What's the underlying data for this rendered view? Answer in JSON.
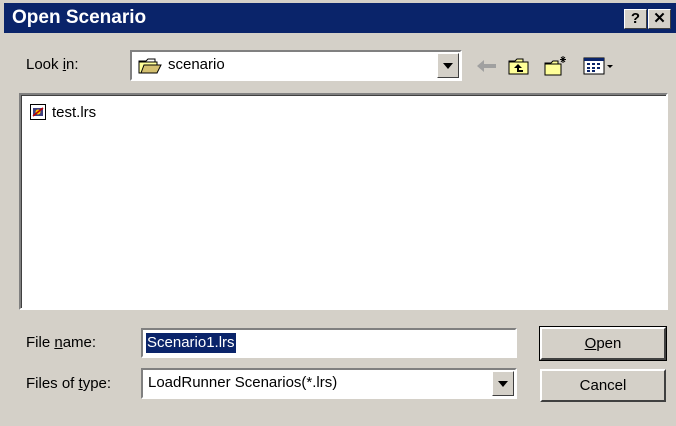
{
  "dialog": {
    "title": "Open Scenario",
    "help_label": "?",
    "close_label": "✕"
  },
  "look_in": {
    "label_pre": "Look ",
    "label_key": "i",
    "label_post": "n:",
    "value": "scenario"
  },
  "toolbar": {
    "icons": [
      "back-arrow-icon",
      "up-one-level-icon",
      "new-folder-icon",
      "view-menu-icon"
    ]
  },
  "files": [
    {
      "name": "test.lrs",
      "icon": "scenario-file-icon"
    }
  ],
  "file_name": {
    "label_pre": "File ",
    "label_key": "n",
    "label_post": "ame:",
    "value": "Scenario1.lrs"
  },
  "file_type": {
    "label_pre": "Files of ",
    "label_key": "t",
    "label_post": "ype:",
    "value": "LoadRunner Scenarios(*.lrs)"
  },
  "buttons": {
    "open_key": "O",
    "open_rest": "pen",
    "cancel": "Cancel"
  },
  "colors": {
    "titlebar": "#0a246a",
    "face": "#d4d0c8",
    "selection": "#0a246a"
  }
}
